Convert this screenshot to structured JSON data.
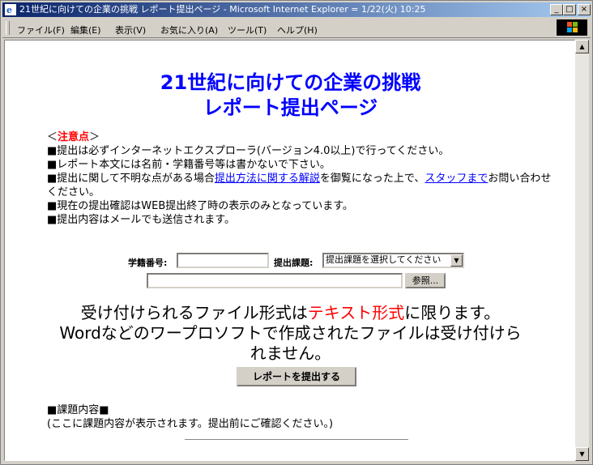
{
  "window": {
    "title": "21世紀に向けての企業の挑戦 レポート提出ページ - Microsoft Internet Explorer = 1/22(火) 10:25",
    "minimize": "_",
    "maximize": "□",
    "close": "×"
  },
  "menubar": {
    "items": [
      "ファイル(F)",
      "編集(E)",
      "表示(V)",
      "お気に入り(A)",
      "ツール(T)",
      "ヘルプ(H)"
    ]
  },
  "page": {
    "heading_line1": "21世紀に向けての企業の挑戦",
    "heading_line2": "レポート提出ページ",
    "notice": {
      "open": "＜",
      "title": "注意点",
      "close": "＞",
      "line1": "■提出は必ずインターネットエクスプローラ(バージョン4.0以上)で行ってください。",
      "line2": "■レポート本文には名前・学籍番号等は書かないで下さい。",
      "line3_pre": "■提出に関して不明な点がある場合",
      "line3_link1": "提出方法に関する解説",
      "line3_mid": "を御覧になった上で、",
      "line3_link2": "スタッフまで",
      "line3_post": "お問い合わせください。",
      "line4": "■現在の提出確認はWEB提出終了時の表示のみとなっています。",
      "line5": "■提出内容はメールでも送信されます。"
    },
    "form": {
      "student_id_label": "学籍番号:",
      "student_id_value": "",
      "assignment_label": "提出課題:",
      "assignment_selected": "提出課題を選択してください",
      "file_value": "",
      "browse_label": "参照..."
    },
    "format_notice": {
      "pre": "受け付けられるファイル形式は",
      "highlight": "テキスト形式",
      "post": "に限ります。",
      "line2": "Wordなどのワープロソフトで作成されたファイルは受け付けら",
      "line3": "れません。"
    },
    "submit_label": "レポートを提出する",
    "assignment_heading": "■課題内容■",
    "assignment_text": "(ここに課題内容が表示されます。提出前にご確認ください。)"
  },
  "colors": {
    "heading": "#0000ff",
    "highlight": "#ff0000",
    "titlebar_start": "#0a246a",
    "titlebar_end": "#a6caf0"
  }
}
